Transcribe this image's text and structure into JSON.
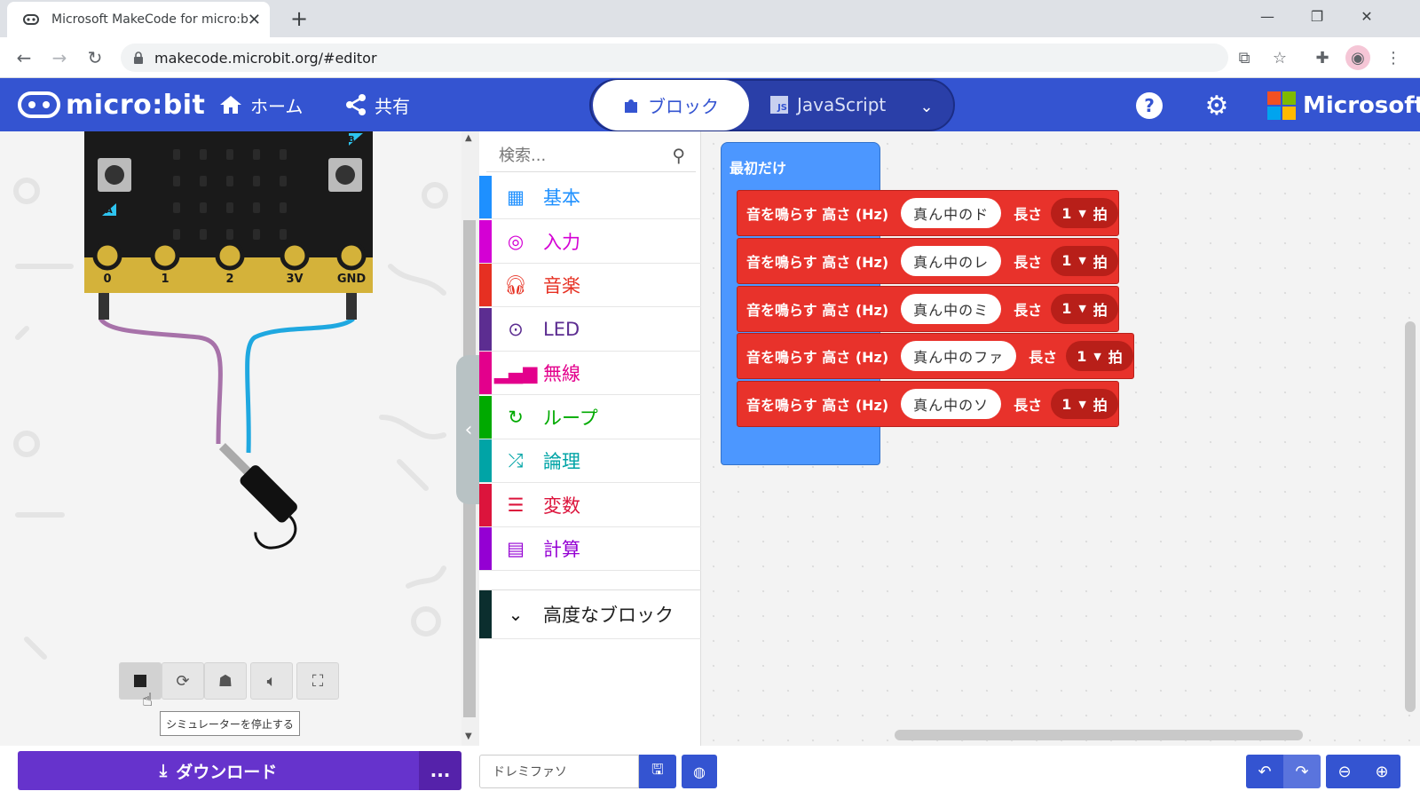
{
  "browser": {
    "tab_title": "Microsoft MakeCode for micro:bit",
    "url": "makecode.microbit.org/#editor",
    "colors": {
      "tabbar": "#dee1e6",
      "omnibox": "#f1f3f4"
    }
  },
  "header": {
    "logo_text": "micro:bit",
    "home_label": "ホーム",
    "share_label": "共有",
    "mode_blocks": "ブロック",
    "mode_js": "JavaScript",
    "js_badge": "JS",
    "brand": "Microsoft",
    "colors": {
      "bg": "#3454d1"
    }
  },
  "simulator": {
    "pin_labels": [
      "0",
      "1",
      "2",
      "3V",
      "GND"
    ],
    "button_a": "A",
    "button_b": "B",
    "tooltip": "シミュレーターを停止する",
    "controls": [
      "stop-icon",
      "restart-icon",
      "debug-icon",
      "sound-icon",
      "fullscreen-icon"
    ]
  },
  "toolbox": {
    "search_placeholder": "検索...",
    "categories": [
      {
        "label": "基本",
        "color": "#1e90ff",
        "icon": "grid-icon"
      },
      {
        "label": "入力",
        "color": "#d400d4",
        "icon": "target-icon"
      },
      {
        "label": "音楽",
        "color": "#e63022",
        "icon": "headphones-icon"
      },
      {
        "label": "LED",
        "color": "#5c2d91",
        "icon": "toggle-icon"
      },
      {
        "label": "無線",
        "color": "#e3008c",
        "icon": "signal-icon"
      },
      {
        "label": "ループ",
        "color": "#00aa00",
        "icon": "loop-icon"
      },
      {
        "label": "論理",
        "color": "#00a4a6",
        "icon": "shuffle-icon"
      },
      {
        "label": "変数",
        "color": "#dc143c",
        "icon": "list-icon"
      },
      {
        "label": "計算",
        "color": "#9400d3",
        "icon": "calculator-icon"
      }
    ],
    "advanced": {
      "label": "高度なブロック",
      "color": "#0b2e2e"
    }
  },
  "workspace": {
    "hat_label": "最初だけ",
    "tone_label": "音を鳴らす 高さ (Hz)",
    "length_label": "長さ",
    "beat_unit": "拍",
    "blocks": [
      {
        "note": "真ん中のド",
        "beats": "1"
      },
      {
        "note": "真ん中のレ",
        "beats": "1"
      },
      {
        "note": "真ん中のミ",
        "beats": "1"
      },
      {
        "note": "真ん中のファ",
        "beats": "1"
      },
      {
        "note": "真ん中のソ",
        "beats": "1"
      }
    ],
    "colors": {
      "hat": "#4c97ff",
      "music": "#e8322b"
    }
  },
  "footer": {
    "download_label": "ダウンロード",
    "more_label": "...",
    "project_name": "ドレミファソ"
  }
}
